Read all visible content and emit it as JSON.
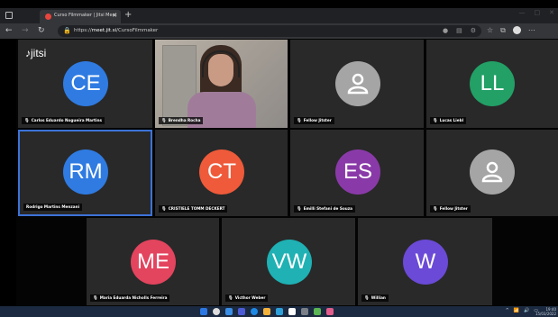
{
  "browser": {
    "tab_title": "Curso Filmmaker | Jitsi Meet",
    "tab_close": "×",
    "new_tab": "+",
    "url_prefix": "https://",
    "url_domain": "meet.jit.si",
    "url_path": "/CursoFilmmaker",
    "window_controls": [
      "—",
      "□",
      "✕"
    ],
    "accent": "#e8453c"
  },
  "meeting": {
    "logo_text": "jitsi",
    "participants": [
      {
        "name": "Carlos Eduardo Nogueira Martins",
        "initials": "CE",
        "color": "#2f7be2",
        "muted": true,
        "type": "avatar"
      },
      {
        "name": "Brendha Rocha",
        "initials": "",
        "color": "",
        "muted": true,
        "type": "video"
      },
      {
        "name": "Fellow Jitster",
        "initials": "",
        "color": "#a5a5a5",
        "muted": true,
        "type": "generic"
      },
      {
        "name": "Lucas Liebl",
        "initials": "LL",
        "color": "#22a066",
        "muted": true,
        "type": "avatar"
      },
      {
        "name": "Rodrigo Martins Menzani",
        "initials": "RM",
        "color": "#2f7be2",
        "muted": false,
        "type": "avatar",
        "active": true
      },
      {
        "name": "CRISTIELE TOMM DECKERT",
        "initials": "CT",
        "color": "#ee5a3a",
        "muted": true,
        "type": "avatar"
      },
      {
        "name": "Emilli Stefani de Souza",
        "initials": "ES",
        "color": "#8a3aa8",
        "muted": true,
        "type": "avatar"
      },
      {
        "name": "Fellow Jitster",
        "initials": "",
        "color": "#a5a5a5",
        "muted": true,
        "type": "generic"
      },
      {
        "name": "Maria Eduarda Nicholls Ferreira",
        "initials": "ME",
        "color": "#e3445e",
        "muted": true,
        "type": "avatar"
      },
      {
        "name": "Victhor Weber",
        "initials": "VW",
        "color": "#1fb1b4",
        "muted": true,
        "type": "avatar"
      },
      {
        "name": "Willian",
        "initials": "W",
        "color": "#6a4ad6",
        "muted": true,
        "type": "avatar"
      }
    ]
  },
  "taskbar": {
    "time": "19:40",
    "date": "15/03/2022",
    "icon_colors": [
      "#2b78e4",
      "#dddddd",
      "#3a8ee6",
      "#4b5bd6",
      "#1e88e5",
      "#f5b23b",
      "#2ea0d9",
      "#ffffff",
      "#7a7f88",
      "#5ab552",
      "#e25d8b"
    ]
  }
}
